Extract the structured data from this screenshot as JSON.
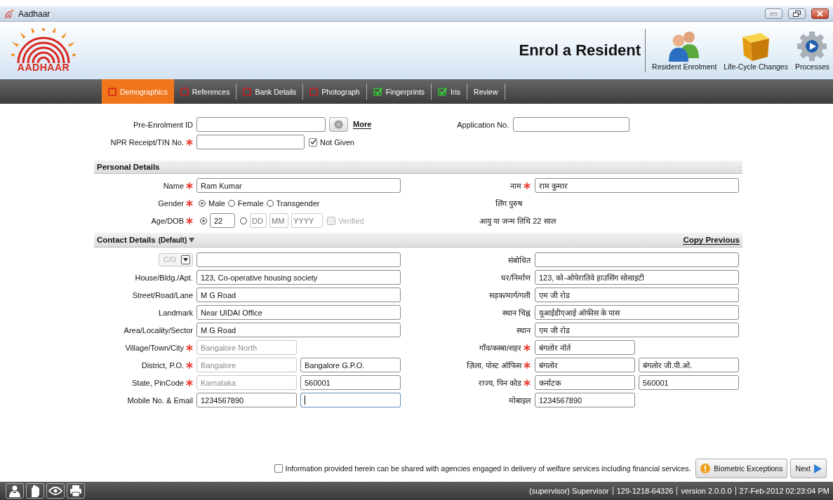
{
  "window": {
    "title": "Aadhaar"
  },
  "header": {
    "logo_text": "AADHAAR",
    "title": "Enrol a Resident",
    "nav": [
      {
        "label": "Resident Enrolment",
        "kind": "people"
      },
      {
        "label": "Life-Cycle Changes",
        "kind": "box"
      },
      {
        "label": "Processes",
        "kind": "gear"
      }
    ]
  },
  "tabs": [
    {
      "label": "Demographics",
      "selected": true,
      "complete": false
    },
    {
      "label": "References",
      "selected": false,
      "complete": false
    },
    {
      "label": "Bank Details",
      "selected": false,
      "complete": false
    },
    {
      "label": "Photograph",
      "selected": false,
      "complete": false
    },
    {
      "label": "Fingerprints",
      "selected": false,
      "complete": true
    },
    {
      "label": "Iris",
      "selected": false,
      "complete": true
    },
    {
      "label": "Review",
      "selected": false
    }
  ],
  "pre_enrolment": {
    "label": "Pre-Enrolment ID",
    "link": "More",
    "application_label": "Application No."
  },
  "npr": {
    "label": "NPR Receipt/TIN No.",
    "required": true,
    "not_given": {
      "label": "Not Given",
      "checked": true
    }
  },
  "personal_details": {
    "title": "Personal Details",
    "name": {
      "label": "Name",
      "required": true,
      "value": "Ram Kumar",
      "label_hi": "नाम",
      "required_hi": true,
      "value_hi": "राम कुमार"
    },
    "gender": {
      "label": "Gender",
      "required": true,
      "options": [
        {
          "label": "Male",
          "selected": true
        },
        {
          "label": "Female",
          "selected": false
        },
        {
          "label": "Transgender",
          "selected": false
        }
      ],
      "summary_hi": "लिंग पुरुष"
    },
    "age_dob": {
      "label": "Age/DOB",
      "required": true,
      "age_option": {
        "selected": true,
        "value": "22"
      },
      "dob_option": {
        "selected": false,
        "placeholders": [
          "DD",
          "MM",
          "YYYY"
        ]
      },
      "verified": {
        "label": "Verified",
        "checked": false,
        "disabled": true
      },
      "summary_hi": "आयु या जन्म तिथि 22 साल"
    }
  },
  "contact_details": {
    "title": "Contact Details",
    "subtitle": "(Default)",
    "copy_link": "Copy Previous",
    "rows": [
      {
        "prefix_select": {
          "value": "C/O",
          "disabled": true
        },
        "fields": [
          {
            "kind": "full"
          }
        ],
        "label_hi": "संबोधित",
        "fields_hi": [
          {
            "kind": "full"
          }
        ]
      },
      {
        "label": "House/Bldg./Apt.",
        "fields": [
          {
            "kind": "full",
            "value": "123, Co-operative housing society"
          }
        ],
        "label_hi": "घर/निर्माण",
        "fields_hi": [
          {
            "kind": "full",
            "value": "123, को-ओपेरातिवे हाउसिंग सोसाइटी"
          }
        ]
      },
      {
        "label": "Street/Road/Lane",
        "fields": [
          {
            "kind": "full",
            "value": "M G Road"
          }
        ],
        "label_hi": "सड़क/मार्ग/गली",
        "fields_hi": [
          {
            "kind": "full",
            "value": "एम जी रोड"
          }
        ]
      },
      {
        "label": "Landmark",
        "fields": [
          {
            "kind": "full",
            "value": "Near UIDAI Office"
          }
        ],
        "label_hi": "स्थान चिह्न",
        "fields_hi": [
          {
            "kind": "full",
            "value": "यूआईडीएआई ऑफीस के पास"
          }
        ]
      },
      {
        "label": "Area/Locality/Sector",
        "fields": [
          {
            "kind": "full",
            "value": "M G Road"
          }
        ],
        "label_hi": "स्थान",
        "fields_hi": [
          {
            "kind": "full",
            "value": "एम जी रोड"
          }
        ]
      },
      {
        "label": "Village/Town/City",
        "required": true,
        "fields": [
          {
            "kind": "half",
            "value": "Bangalore North",
            "disabled": true
          }
        ],
        "label_hi": "गाँव/कस्बा/शहर",
        "required_hi": true,
        "fields_hi": [
          {
            "kind": "half",
            "value": "बंगलोर नॉर्त"
          }
        ]
      },
      {
        "label": "District, P.O.",
        "required": true,
        "fields": [
          {
            "kind": "half",
            "value": "Bangalore",
            "disabled": true
          },
          {
            "kind": "half",
            "value": "Bangalore G.P.O."
          }
        ],
        "label_hi": "ज़िला, पोस्ट ऑफिस",
        "required_hi": true,
        "fields_hi": [
          {
            "kind": "half",
            "value": "बंगलोर"
          },
          {
            "kind": "half",
            "value": "बंगलोर जी.पी.ओ."
          }
        ]
      },
      {
        "label": "State, PinCode",
        "required": true,
        "fields": [
          {
            "kind": "half",
            "value": "Karnataka",
            "disabled": true
          },
          {
            "kind": "half",
            "value": "560001"
          }
        ],
        "label_hi": "राज्य, पिन कोड",
        "required_hi": true,
        "fields_hi": [
          {
            "kind": "half",
            "value": "कर्नाटक"
          },
          {
            "kind": "half",
            "value": "560001"
          }
        ]
      },
      {
        "label": "Mobile No. & Email",
        "fields": [
          {
            "kind": "half",
            "value": "1234567890"
          },
          {
            "kind": "half",
            "focused": true
          }
        ],
        "label_hi": "मोबाइल",
        "fields_hi": [
          {
            "kind": "half",
            "value": "1234567890"
          }
        ]
      }
    ]
  },
  "consent": {
    "label": "Information provided herein can be shared with agencies engaged in delivery of welfare services including financial services.",
    "checked": false
  },
  "buttons": [
    {
      "label": "Biometric Exceptions",
      "kind": "warning"
    },
    {
      "label": "Next",
      "kind": "next"
    }
  ],
  "status_bar": {
    "tools": [
      {
        "kind": "person"
      },
      {
        "kind": "hand"
      },
      {
        "kind": "eye"
      },
      {
        "kind": "printer"
      }
    ],
    "items": [
      "(supervisor) Supervisor",
      "129-1218-64326",
      "version 2.0.0.0",
      "27-Feb-2012 02:23:04 PM"
    ]
  }
}
